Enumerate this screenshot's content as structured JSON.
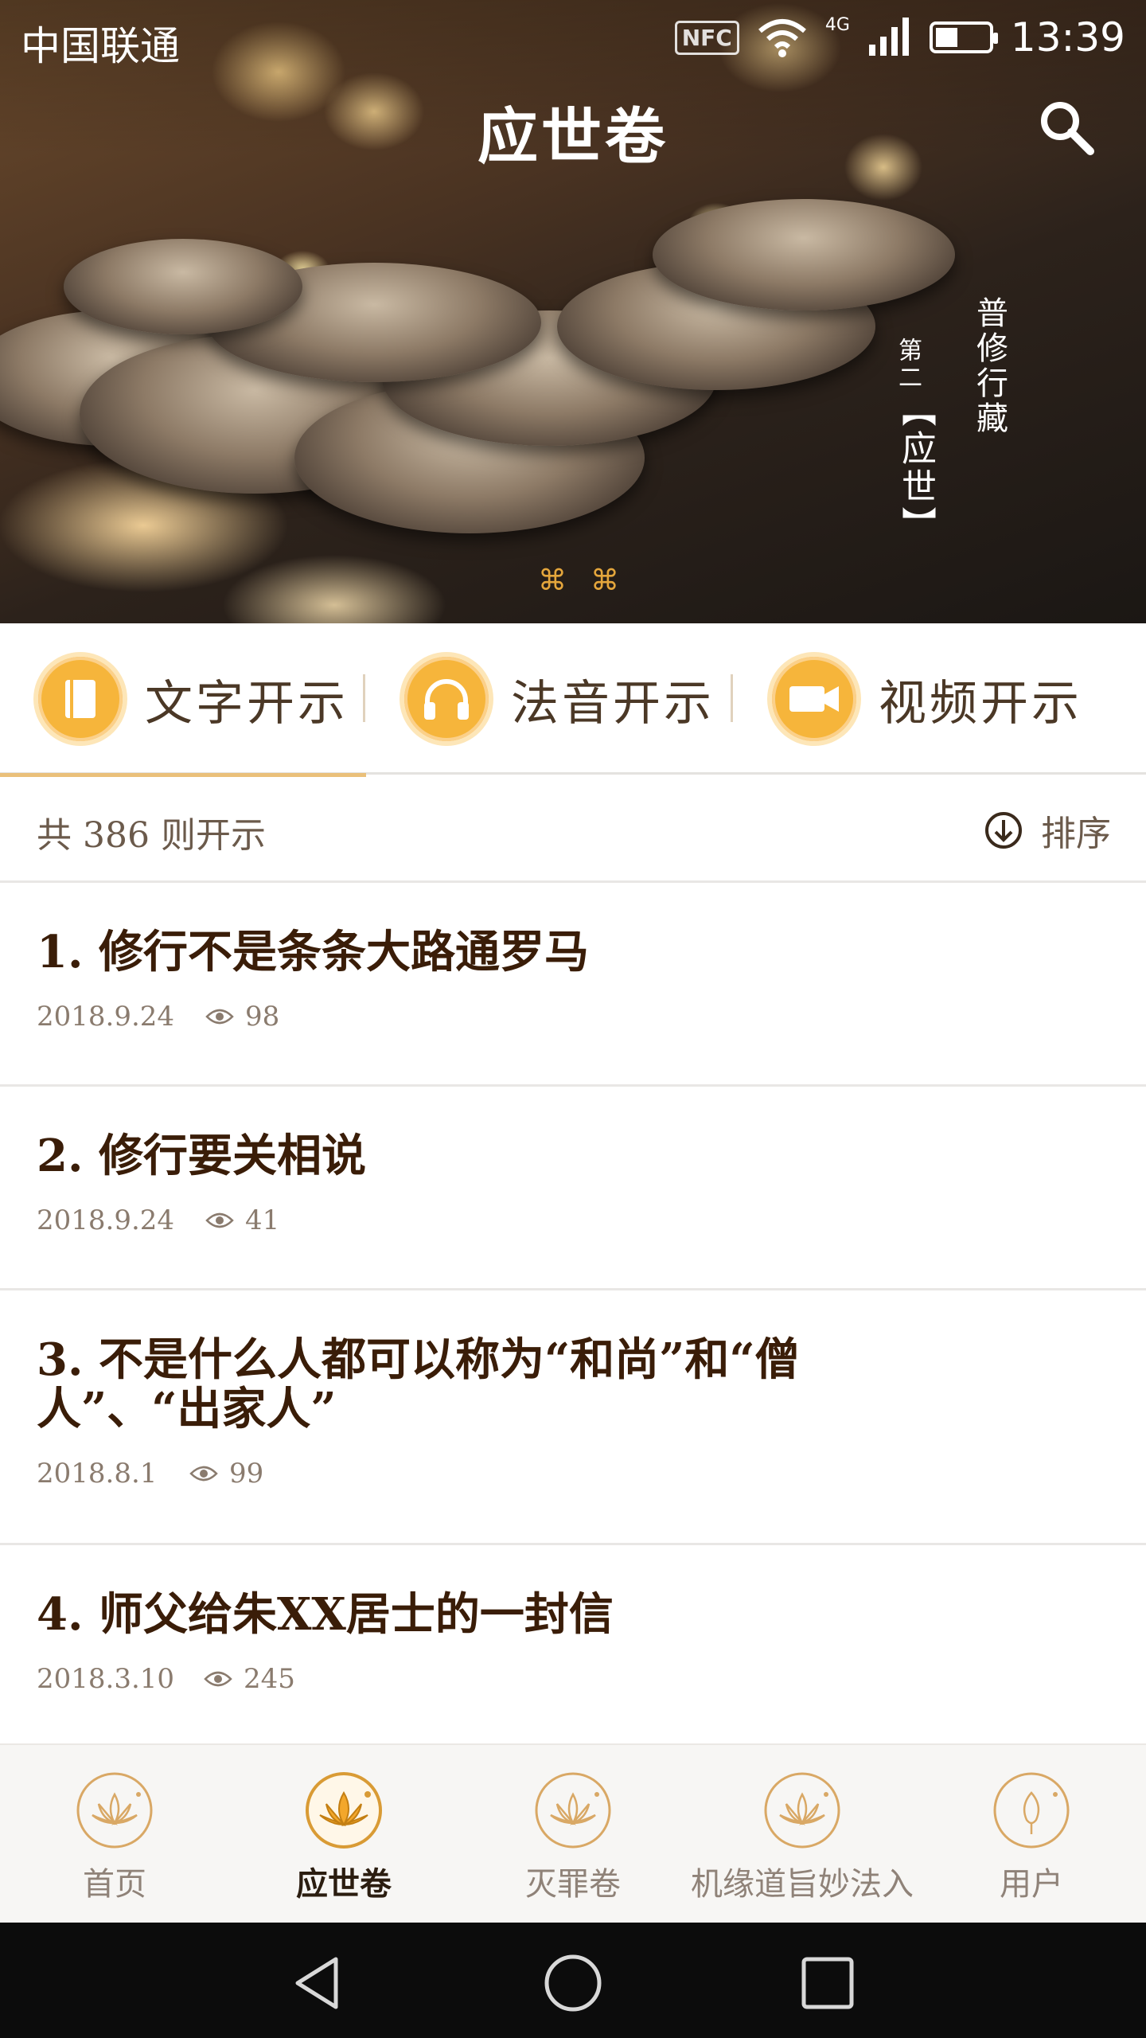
{
  "status_bar": {
    "carrier": "中国联通",
    "nfc": "NFC",
    "network": "4G",
    "time": "13:39"
  },
  "header": {
    "title": "应世卷",
    "search_icon": "search-icon"
  },
  "banner": {
    "vertical_text_1": "普修行藏",
    "vertical_text_2": "第二",
    "vertical_text_3": "【应世】",
    "indicator_glyph": "⌘",
    "indicators": 2
  },
  "tabs": [
    {
      "label": "文字开示",
      "icon": "book-icon",
      "active": true
    },
    {
      "label": "法音开示",
      "icon": "headphones-icon",
      "active": false
    },
    {
      "label": "视频开示",
      "icon": "video-camera-icon",
      "active": false
    }
  ],
  "summary": {
    "count_text": "共 386 则开示",
    "sort_label": "排序",
    "sort_icon": "arrow-down-circle-icon"
  },
  "items": [
    {
      "title": "1. 修行不是条条大路通罗马",
      "date": "2018.9.24",
      "views": "98"
    },
    {
      "title": "2. 修行要关相说",
      "date": "2018.9.24",
      "views": "41"
    },
    {
      "title_line1": "3. 不是什么人都可以称为“和尚”和“僧",
      "title_line2": "人”、“出家人”",
      "date": "2018.8.1",
      "views": "99"
    },
    {
      "title": "4. 师父给朱XX居士的一封信",
      "date": "2018.3.10",
      "views": "245"
    }
  ],
  "bottom_nav": [
    {
      "label": "首页",
      "icon": "lotus-icon",
      "active": false
    },
    {
      "label": "应世卷",
      "icon": "lotus-icon",
      "active": true
    },
    {
      "label": "灭罪卷",
      "icon": "lotus-icon",
      "active": false
    },
    {
      "label": "机缘道旨妙法入",
      "icon": "lotus-icon",
      "active": false
    },
    {
      "label": "用户",
      "icon": "lotus-bud-icon",
      "active": false
    }
  ],
  "colors": {
    "accent": "#f6b53b",
    "accent_light": "#eac07a",
    "title_text": "#3a1d08",
    "meta_text": "#8a7b6e"
  }
}
